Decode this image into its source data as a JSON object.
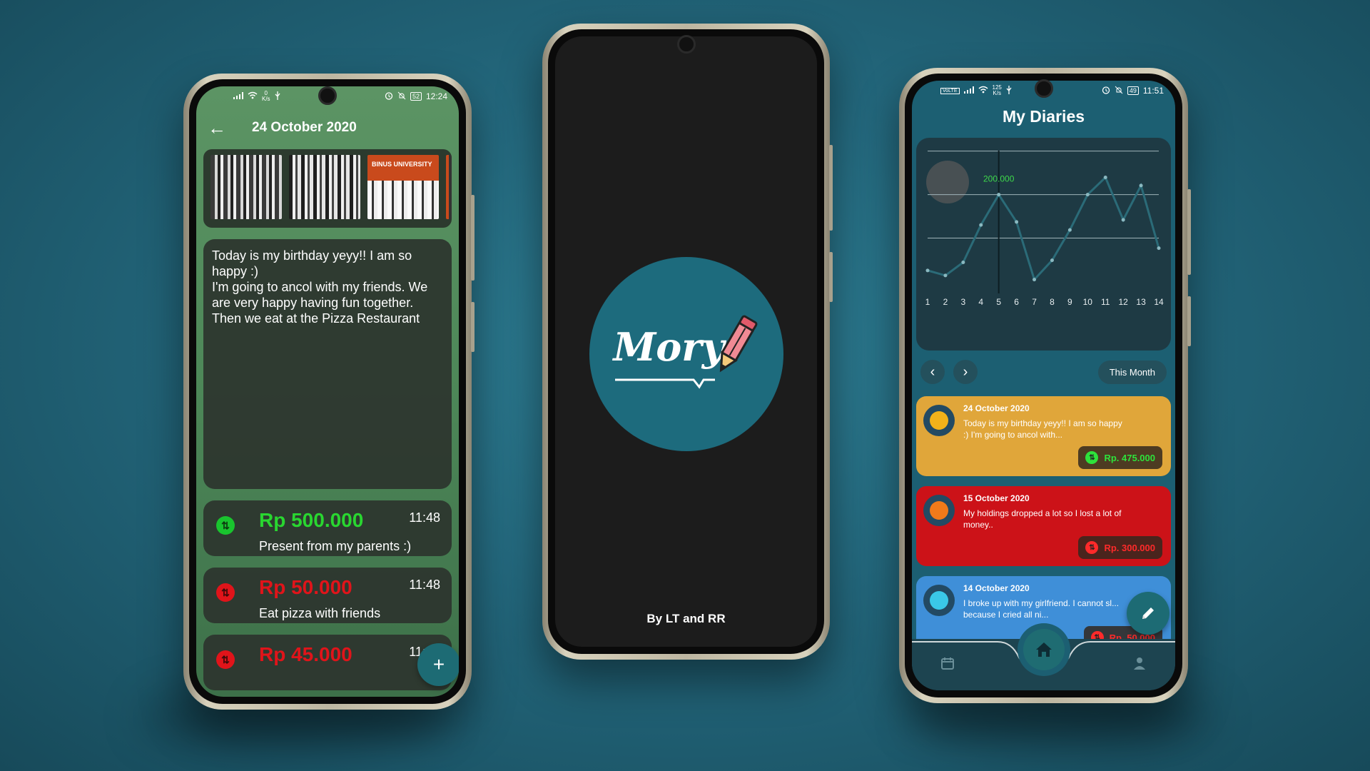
{
  "left_phone": {
    "status": {
      "speed": "0",
      "speed_unit": "K/s",
      "battery": "52",
      "time": "12:24"
    },
    "header": {
      "title": "24 October 2020"
    },
    "photos": [
      {
        "tag": ""
      },
      {
        "tag": ""
      },
      {
        "tag": "BINUS UNIVERSITY"
      },
      {
        "tag": ""
      }
    ],
    "diary_text": {
      "line1": "Today is my birthday yeyy!! I am so happy :)",
      "line2": "I'm going to ancol with my friends. We are very happy having fun together. Then we eat at the Pizza Restaurant"
    },
    "transactions": [
      {
        "amount": "Rp 500.000",
        "time": "11:48",
        "note": "Present from my parents :)",
        "type": "income"
      },
      {
        "amount": "Rp 50.000",
        "time": "11:48",
        "note": "Eat pizza with friends",
        "type": "expense"
      },
      {
        "amount": "Rp 45.000",
        "time": "11:49",
        "note": "",
        "type": "expense"
      }
    ],
    "fab_label": "+"
  },
  "middle_phone": {
    "logo_text": "Mory",
    "credit": "By LT and RR"
  },
  "right_phone": {
    "status": {
      "speed": "125",
      "speed_unit": "K/s",
      "battery": "49",
      "time": "11:51"
    },
    "title": "My Diaries",
    "month_button": "This Month",
    "entries": [
      {
        "date": "24 October 2020",
        "text": "Today is my birthday yeyy!! I am so happy :) I'm going to ancol with...",
        "amount": "Rp. 475.000",
        "color": "#e0a63a",
        "amount_color": "#2ee23b",
        "face_color": "#f2b21a"
      },
      {
        "date": "15 October 2020",
        "text": "My holdings dropped a lot so I lost a lot of money..",
        "amount": "Rp. 300.000",
        "color": "#cc1218",
        "amount_color": "#ff2a2a",
        "face_color": "#f07a1a"
      },
      {
        "date": "14 October 2020",
        "text": "I broke up with my girlfriend. I cannot sl... because I cried all ni...",
        "amount": "Rp. 50.000",
        "color": "#3f8fd8",
        "amount_color": "#ff2a2a",
        "face_color": "#3ac8e8"
      }
    ]
  },
  "chart_data": {
    "type": "line",
    "x": [
      1,
      2,
      3,
      4,
      5,
      6,
      7,
      8,
      9,
      10,
      11,
      12,
      13,
      14
    ],
    "values": [
      10,
      5,
      18,
      55,
      85,
      58,
      1,
      20,
      50,
      85,
      102,
      60,
      94,
      32
    ],
    "highlight": {
      "x": 5,
      "label": "200.000"
    },
    "grid": true,
    "line_color": "#2b6b78",
    "point_color": "#8ab8c0"
  }
}
